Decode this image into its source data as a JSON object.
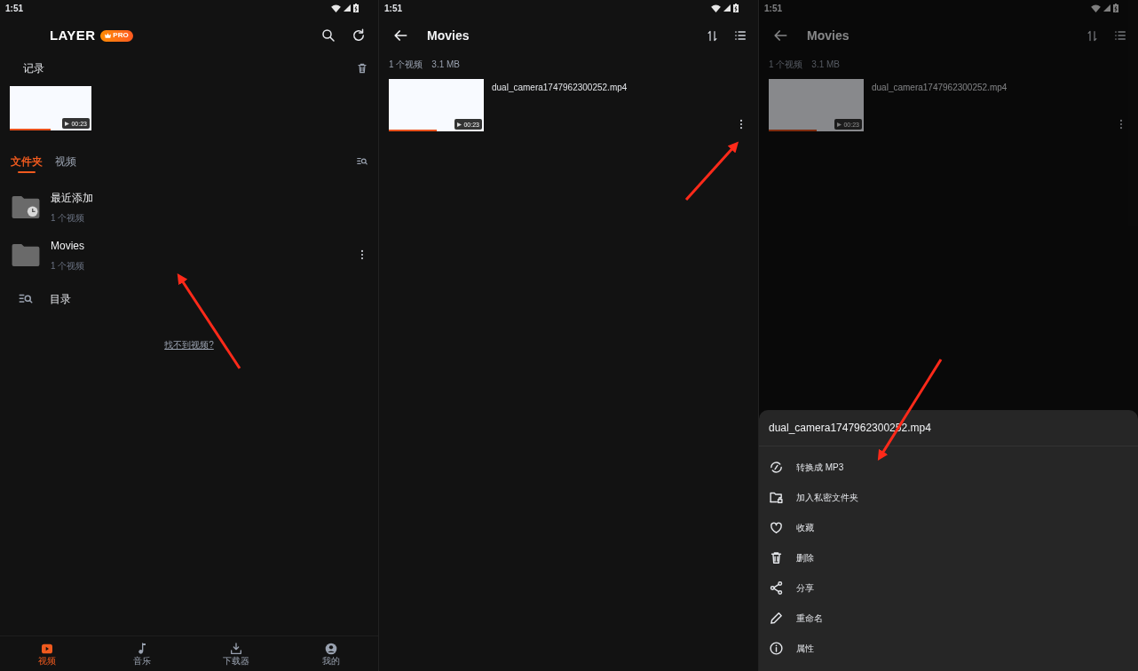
{
  "home": {
    "status_time": "1:51",
    "brand": "LAYER",
    "badge": "PRO",
    "history_title": "记录",
    "history": [
      {
        "duration": "00:23",
        "level": 0.5
      }
    ],
    "tabs": [
      {
        "label": "文件夹",
        "selected": true
      },
      {
        "label": "视频",
        "selected": false
      }
    ],
    "folders": [
      {
        "name": "最近添加",
        "count": "1 个视频",
        "kind": "recent",
        "menu": false
      },
      {
        "name": "Movies",
        "count": "1 个视频",
        "kind": "plain",
        "menu": true
      }
    ],
    "directory": "目录",
    "help_link": "找不到视频?",
    "nav": [
      {
        "label": "视频",
        "kind": "video",
        "selected": true
      },
      {
        "label": "音乐",
        "kind": "music",
        "selected": false
      },
      {
        "label": "下载器",
        "kind": "download",
        "selected": false
      },
      {
        "label": "我的",
        "kind": "me",
        "selected": false
      }
    ]
  },
  "folder_views": [
    {
      "status_time": "1:51",
      "title": "Movies",
      "summary_count": "1 个视频",
      "summary_size": "3.1 MB",
      "dimmed": false,
      "videos": [
        {
          "name": "dual_camera1747962300252.mp4",
          "duration": "00:23",
          "level": 0.5
        }
      ]
    },
    {
      "status_time": "1:51",
      "title": "Movies",
      "summary_count": "1 个视频",
      "summary_size": "3.1 MB",
      "dimmed": true,
      "videos": [
        {
          "name": "dual_camera1747962300252.mp4",
          "duration": "00:23",
          "level": 0.5
        }
      ],
      "sheet": {
        "title": "dual_camera1747962300252.mp4",
        "actions": [
          {
            "label": "转换成 MP3",
            "kind": "convert"
          },
          {
            "label": "加入私密文件夹",
            "kind": "private"
          },
          {
            "label": "收藏",
            "kind": "favorite"
          },
          {
            "label": "删除",
            "kind": "delete"
          },
          {
            "label": "分享",
            "kind": "share"
          },
          {
            "label": "重命名",
            "kind": "rename"
          },
          {
            "label": "属性",
            "kind": "info"
          }
        ]
      }
    }
  ]
}
